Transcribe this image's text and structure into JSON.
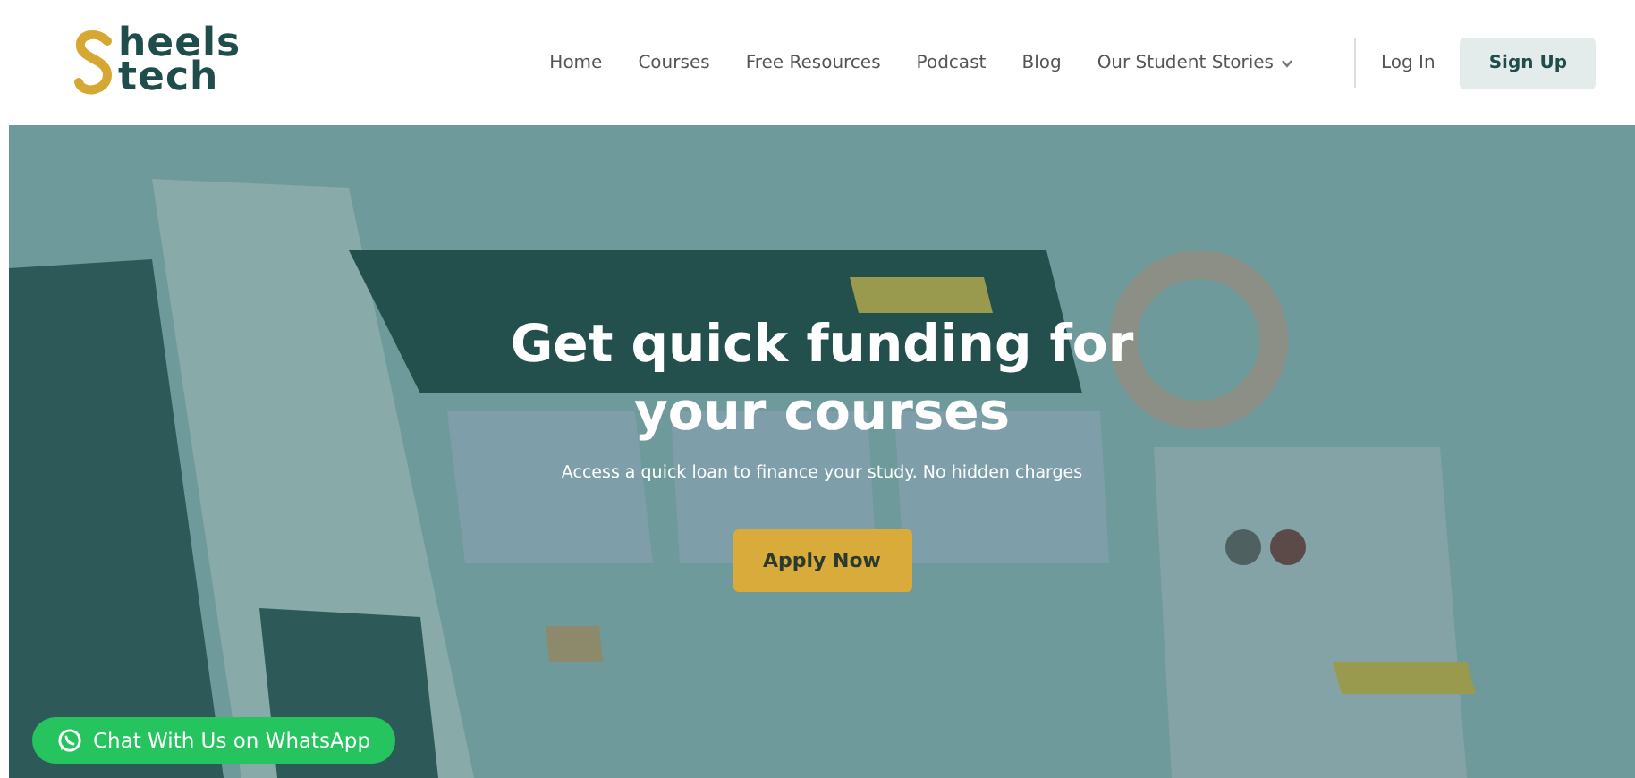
{
  "logo": {
    "lines": [
      "heels",
      "tech"
    ]
  },
  "nav": [
    {
      "label": "Home",
      "dropdown": false
    },
    {
      "label": "Courses",
      "dropdown": false
    },
    {
      "label": "Free Resources",
      "dropdown": false
    },
    {
      "label": "Podcast",
      "dropdown": false
    },
    {
      "label": "Blog",
      "dropdown": false
    },
    {
      "label": "Our Student Stories",
      "dropdown": true
    }
  ],
  "auth": {
    "login": "Log In",
    "signup": "Sign Up"
  },
  "hero": {
    "title": "Get quick funding for your courses",
    "subtitle": "Access a quick loan to finance your study. No hidden charges",
    "button": "Apply Now"
  },
  "chat_button": {
    "label": "Chat With Us on WhatsApp"
  }
}
